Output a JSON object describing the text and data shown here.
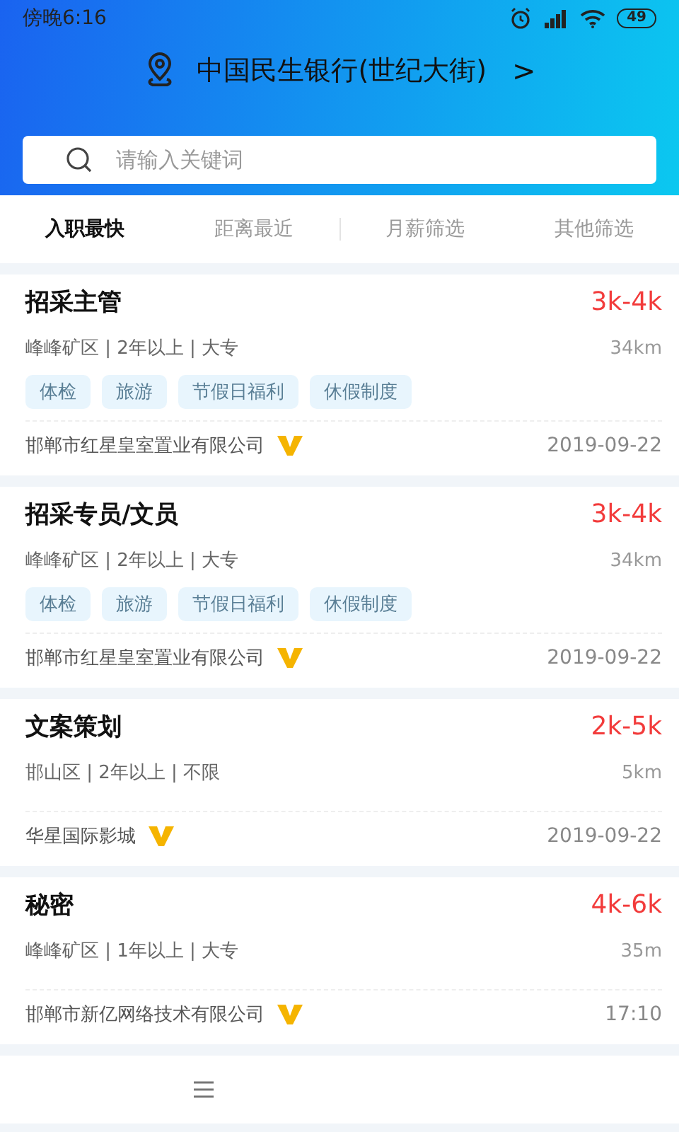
{
  "status_bar": {
    "time": "傍晚6:16",
    "battery": "49"
  },
  "location": {
    "name": "中国民生银行(世纪大街)",
    "chevron": ">"
  },
  "search": {
    "placeholder": "请输入关键词"
  },
  "filters": [
    {
      "label": "入职最快",
      "selected": true
    },
    {
      "label": "距离最近",
      "selected": false
    },
    {
      "label": "月薪筛选",
      "selected": false
    },
    {
      "label": "其他筛选",
      "selected": false
    }
  ],
  "jobs": [
    {
      "title": "招采主管",
      "salary": "3k-4k",
      "meta": "峰峰矿区 | 2年以上 | 大专",
      "distance": "34km",
      "tags": [
        "体检",
        "旅游",
        "节假日福利",
        "休假制度"
      ],
      "company": "邯郸市红星皇室置业有限公司",
      "verified": true,
      "date": "2019-09-22"
    },
    {
      "title": "招采专员/文员",
      "salary": "3k-4k",
      "meta": "峰峰矿区 | 2年以上 | 大专",
      "distance": "34km",
      "tags": [
        "体检",
        "旅游",
        "节假日福利",
        "休假制度"
      ],
      "company": "邯郸市红星皇室置业有限公司",
      "verified": true,
      "date": "2019-09-22"
    },
    {
      "title": "文案策划",
      "salary": "2k-5k",
      "meta": "邯山区 | 2年以上 | 不限",
      "distance": "5km",
      "company": "华星国际影城",
      "verified": true,
      "date": "2019-09-22"
    },
    {
      "title": "秘密",
      "salary": "4k-6k",
      "meta": "峰峰矿区 | 1年以上 | 大专",
      "distance": "35m",
      "company": "邯郸市新亿网络技术有限公司",
      "verified": true,
      "date": "17:10"
    }
  ]
}
